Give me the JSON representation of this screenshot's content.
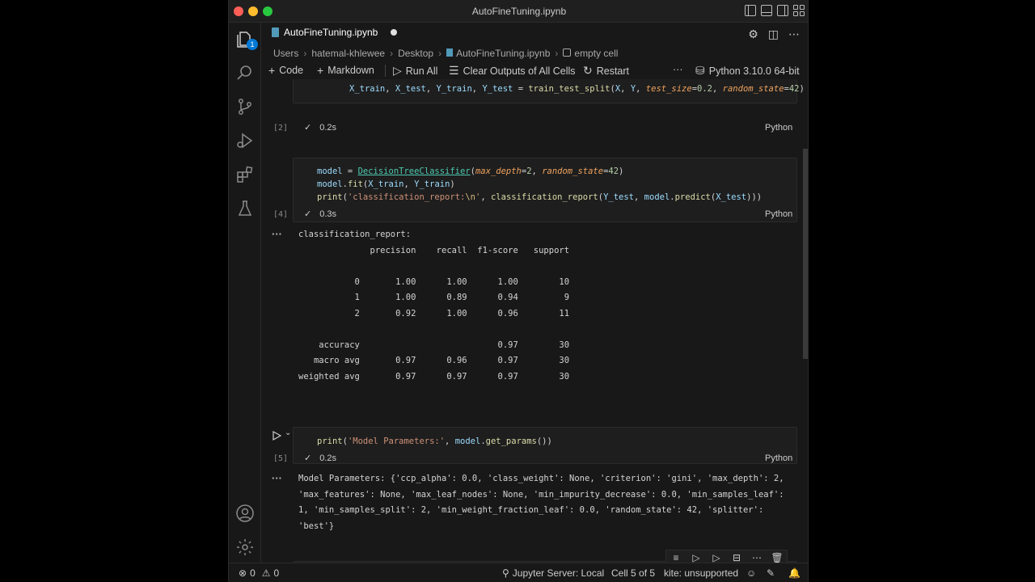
{
  "window": {
    "title": "AutoFineTuning.ipynb"
  },
  "tab": {
    "label": "AutoFineTuning.ipynb",
    "modified": true
  },
  "activity": {
    "explorer_badge": "1"
  },
  "breadcrumb": [
    "Users",
    "hatemal-khlewee",
    "Desktop",
    "AutoFineTuning.ipynb",
    "empty cell"
  ],
  "toolbar": {
    "code": "Code",
    "markdown": "Markdown",
    "run_all": "Run All",
    "clear_outputs": "Clear Outputs of All Cells",
    "restart": "Restart",
    "more": "···",
    "kernel": "Python 3.10.0 64-bit"
  },
  "cells": [
    {
      "exec": "[2]",
      "time": "0.2s",
      "lang": "Python",
      "code": [
        "X_train, X_test, Y_train, Y_test = train_test_split(X, Y, test_size=0.2, random_state=42)"
      ]
    },
    {
      "exec": "[4]",
      "time": "0.3s",
      "lang": "Python",
      "code": [
        "model = DecisionTreeClassifier(max_depth=2, random_state=42)",
        "model.fit(X_train, Y_train)",
        "print('classification_report:\\n', classification_report(Y_test, model.predict(X_test)))"
      ],
      "output": [
        "classification_report:",
        "              precision    recall  f1-score   support",
        "",
        "           0       1.00      1.00      1.00        10",
        "           1       1.00      0.89      0.94         9",
        "           2       0.92      1.00      0.96        11",
        "",
        "    accuracy                           0.97        30",
        "   macro avg       0.97      0.96      0.97        30",
        "weighted avg       0.97      0.97      0.97        30"
      ]
    },
    {
      "exec": "[5]",
      "time": "0.2s",
      "lang": "Python",
      "code": [
        "print('Model Parameters:', model.get_params())"
      ],
      "output": [
        "Model Parameters: {'ccp_alpha': 0.0, 'class_weight': None, 'criterion': 'gini', 'max_depth': 2,",
        "'max_features': None, 'max_leaf_nodes': None, 'min_impurity_decrease': 0.0, 'min_samples_leaf':",
        "1, 'min_samples_split': 2, 'min_weight_fraction_leaf': 0.0, 'random_state': 42, 'splitter':",
        "'best'}"
      ]
    }
  ],
  "statusbar": {
    "errors": "0",
    "warnings": "0",
    "jupyter": "Jupyter Server: Local",
    "cell": "Cell 5 of 5",
    "kite": "kite: unsupported"
  }
}
